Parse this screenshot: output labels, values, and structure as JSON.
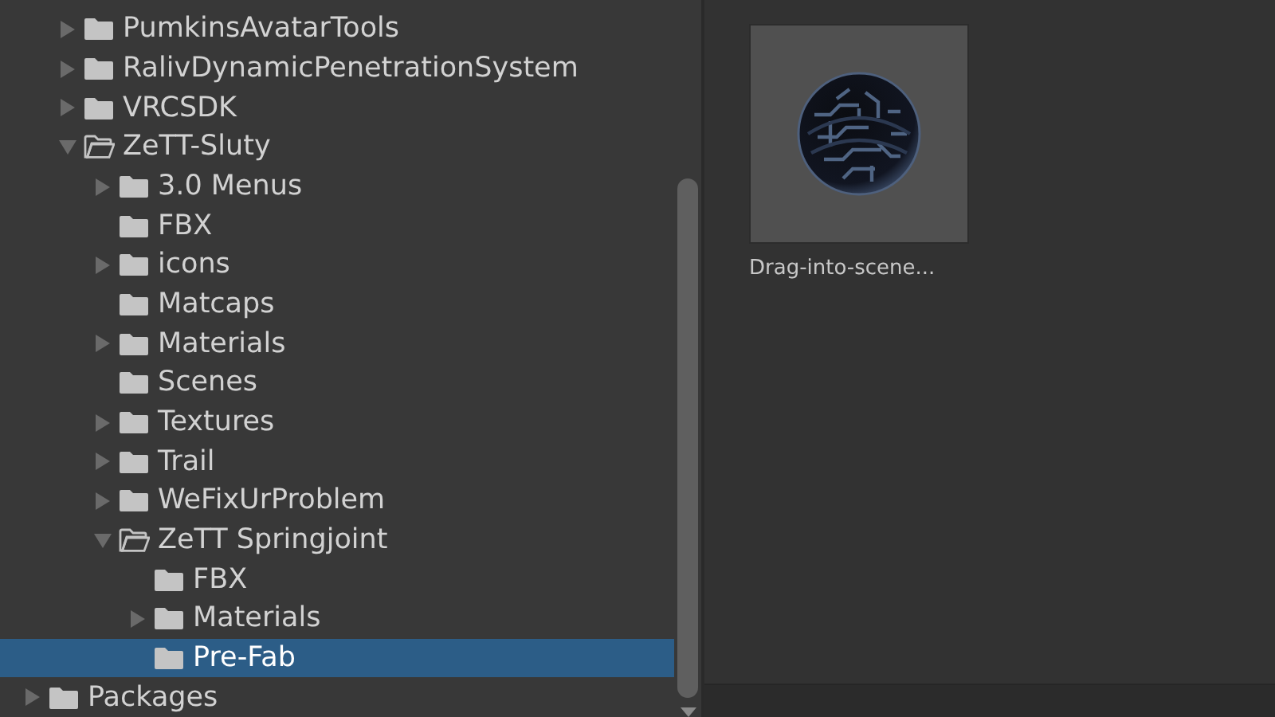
{
  "tree": [
    {
      "label": "PumkinsAvatarTools",
      "expandable": true,
      "expanded": false,
      "selected": false
    },
    {
      "label": "RalivDynamicPenetrationSystem",
      "expandable": true,
      "expanded": false,
      "selected": false
    },
    {
      "label": "VRCSDK",
      "expandable": true,
      "expanded": false,
      "selected": false
    },
    {
      "label": "ZeTT-Sluty",
      "expandable": true,
      "expanded": true,
      "selected": false,
      "children": [
        {
          "label": "3.0 Menus",
          "expandable": true,
          "expanded": false,
          "selected": false
        },
        {
          "label": "FBX",
          "expandable": false,
          "expanded": false,
          "selected": false
        },
        {
          "label": "icons",
          "expandable": true,
          "expanded": false,
          "selected": false
        },
        {
          "label": "Matcaps",
          "expandable": false,
          "expanded": false,
          "selected": false
        },
        {
          "label": "Materials",
          "expandable": true,
          "expanded": false,
          "selected": false
        },
        {
          "label": "Scenes",
          "expandable": false,
          "expanded": false,
          "selected": false
        },
        {
          "label": "Textures",
          "expandable": true,
          "expanded": false,
          "selected": false
        },
        {
          "label": "Trail",
          "expandable": true,
          "expanded": false,
          "selected": false
        },
        {
          "label": "WeFixUrProblem",
          "expandable": true,
          "expanded": false,
          "selected": false
        },
        {
          "label": "ZeTT Springjoint",
          "expandable": true,
          "expanded": true,
          "selected": false,
          "children": [
            {
              "label": "FBX",
              "expandable": false,
              "expanded": false,
              "selected": false
            },
            {
              "label": "Materials",
              "expandable": true,
              "expanded": false,
              "selected": false
            },
            {
              "label": "Pre-Fab",
              "expandable": false,
              "expanded": false,
              "selected": true
            }
          ]
        }
      ]
    }
  ],
  "root_folders": [
    {
      "label": "Packages",
      "expandable": true,
      "expanded": false,
      "selected": false
    }
  ],
  "assets": [
    {
      "label": "Drag-into-scene...",
      "selected": false
    }
  ]
}
